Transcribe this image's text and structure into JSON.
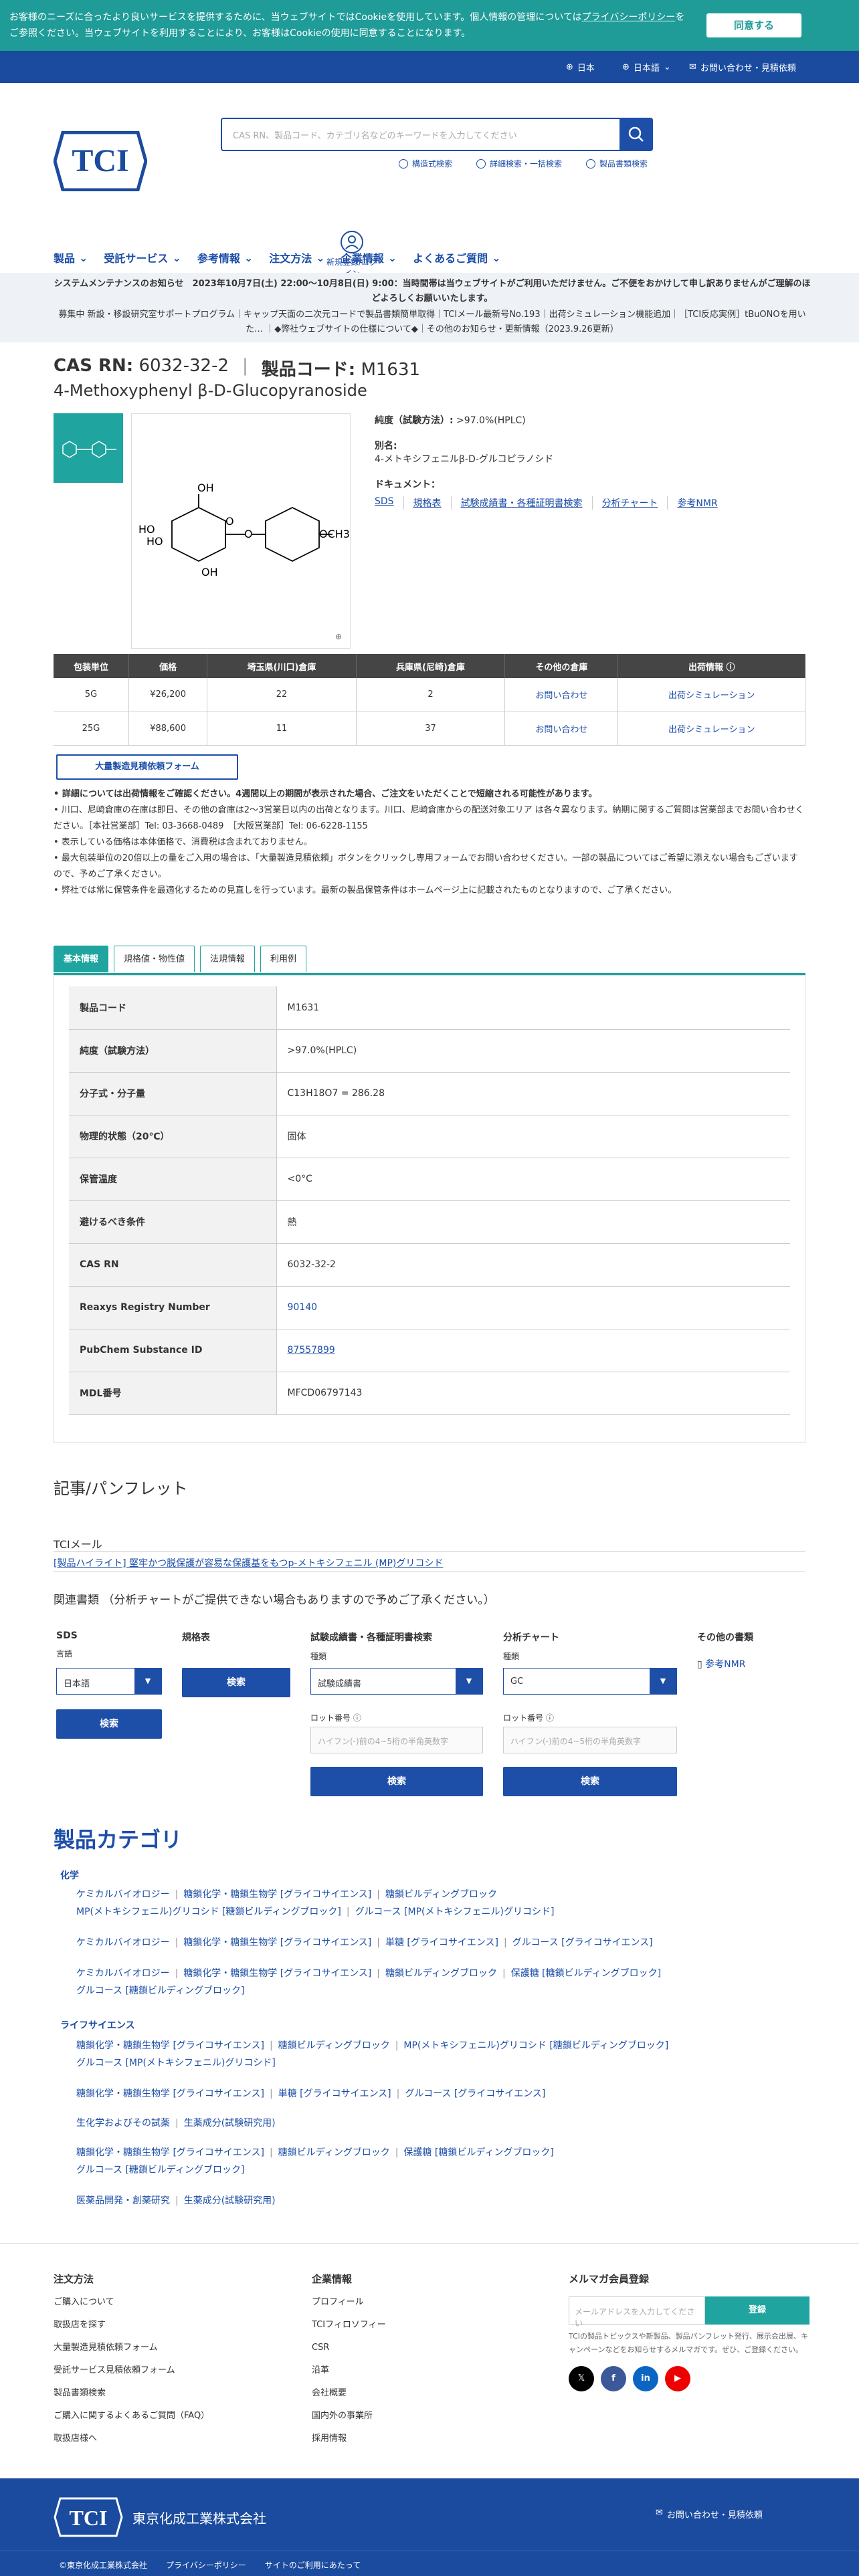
{
  "cookie": {
    "text": "お客様のニーズに合ったより良いサービスを提供するために、当ウェブサイトではCookieを使用しています。個人情報の管理については",
    "link": "プライバシーポリシー",
    "text2": "をご参照ください。当ウェブサイトを利用することにより、お客様はCookieの使用に同意することになります。",
    "button": "同意する"
  },
  "topbar": {
    "country": "日本",
    "language": "日本語",
    "contact": "お問い合わせ・見積依頼"
  },
  "search": {
    "placeholder": "CAS RN、製品コード、カテゴリ名などのキーワードを入力してください",
    "links": [
      "構造式検索",
      "詳細検索・一括検索",
      "製品書類検索"
    ]
  },
  "login": "新規登録/ログイン",
  "nav": [
    "製品",
    "受託サービス",
    "参考情報",
    "注文方法",
    "企業情報",
    "よくあるご質問"
  ],
  "notice": {
    "line1": "システムメンテナンスのお知らせ　2023年10月7日(土) 22:00～10月8日(日) 9:00：当時間帯は当ウェブサイトがご利用いただけません。ご不便をおかけして申し訳ありませんがご理解のほどよろしくお願いいたします。",
    "line2": "募集中 新設・移設研究室サポートプログラム｜キャップ天面の二次元コードで製品書類簡単取得｜TCIメール最新号No.193｜出荷シミュレーション機能追加｜［TCI反応実例］tBuONOを用いた… ｜◆弊社ウェブサイトの仕様について◆｜その他のお知らせ・更新情報（2023.9.26更新）"
  },
  "product": {
    "cas_label": "CAS RN:",
    "cas": "6032-32-2",
    "code_label": "製品コード:",
    "code": "M1631",
    "name": "4-Methoxyphenyl β-D-Glucopyranoside"
  },
  "info": {
    "purity_label": "純度（試験方法）:",
    "purity": ">97.0%(HPLC)",
    "alias_label": "別名:",
    "alias": "4-メトキシフェニルβ-D-グルコピラノシド",
    "docs_label": "ドキュメント：",
    "docs": [
      "SDS",
      "規格表",
      "試験成績書・各種証明書検索",
      "分析チャート",
      "参考NMR"
    ]
  },
  "stock": {
    "headers": [
      "包装単位",
      "価格",
      "埼玉県(川口)倉庫",
      "兵庫県(尼崎)倉庫",
      "その他の倉庫",
      "出荷情報"
    ],
    "rows": [
      [
        "5G",
        "¥26,200",
        "22",
        "2",
        "お問い合わせ",
        "出荷シミュレーション"
      ],
      [
        "25G",
        "¥88,600",
        "11",
        "37",
        "お問い合わせ",
        "出荷シミュレーション"
      ]
    ]
  },
  "bulk_button": "大量製造見積依頼フォーム",
  "notes": [
    "• 詳細については出荷情報をご確認ください。4週間以上の期間が表示された場合、ご注文をいただくことで短縮される可能性があります。",
    "• 川口、尼崎倉庫の在庫は即日、その他の倉庫は2～3営業日以内の出荷となります。川口、尼崎倉庫からの配送対象エリア は各々異なります。納期に関するご質問は営業部までお問い合わせください。［本社営業部］Tel: 03-3668-0489　［大阪営業部］Tel: 06-6228-1155",
    "• 表示している価格は本体価格で、消費税は含まれておりません。",
    "• 最大包装単位の20倍以上の量をご入用の場合は、「大量製造見積依頼」ボタンをクリックし専用フォームでお問い合わせください。一部の製品についてはご希望に添えない場合もございますので、予めご了承ください。",
    "• 弊社では常に保管条件を最適化するための見直しを行っています。最新の製品保管条件はホームページ上に記載されたものとなりますので、ご了承ください。"
  ],
  "tabs": [
    "基本情報",
    "規格値・物性値",
    "法規情報",
    "利用例"
  ],
  "basic": [
    [
      "製品コード",
      "M1631"
    ],
    [
      "純度（試験方法）",
      ">97.0%(HPLC)"
    ],
    [
      "分子式・分子量",
      "C13H18O7 = 286.28"
    ],
    [
      "物理的状態（20℃）",
      "固体"
    ],
    [
      "保管温度",
      "<0°C"
    ],
    [
      "避けるべき条件",
      "熱"
    ],
    [
      "CAS RN",
      "6032-32-2"
    ],
    [
      "Reaxys Registry Number",
      "90140"
    ],
    [
      "PubChem Substance ID",
      "87557899"
    ],
    [
      "MDL番号",
      "MFCD06797143"
    ]
  ],
  "articles": {
    "title": "記事/パンフレット",
    "sub": "TCIメール",
    "link": "[製品ハイライト] 堅牢かつ脱保護が容易な保護基をもつp-メトキシフェニル (MP)グリコシド"
  },
  "related": "関連書類 （分析チャートがご提供できない場合もありますので予めご了承ください。）",
  "docs_forms": {
    "sds": "SDS",
    "lang_label": "言語",
    "lang": "日本語",
    "spec": "規格表",
    "coa": "試験成績書・各種証明書検索",
    "kind_label": "種類",
    "coa_kind": "試験成績書",
    "lot_label": "ロット番号",
    "lot_ph": "ハイフン(-)前の4~5桁の半角英数字",
    "chart": "分析チャート",
    "chart_kind": "GC",
    "other": "その他の書類",
    "nmr": "参考NMR",
    "search": "検索"
  },
  "categories": {
    "title": "製品カテゴリ",
    "chem": "化学",
    "life": "ライフサイエンス",
    "rows": [
      [
        "ケミカルバイオロジー",
        "糖鎖化学・糖鎖生物学 [グライコサイエンス]",
        "糖鎖ビルディングブロック"
      ],
      [
        "MP(メトキシフェニル)グリコシド [糖鎖ビルディングブロック]",
        "グルコース [MP(メトキシフェニル)グリコシド]"
      ],
      [
        "ケミカルバイオロジー",
        "糖鎖化学・糖鎖生物学 [グライコサイエンス]",
        "単糖 [グライコサイエンス]",
        "グルコース [グライコサイエンス]"
      ],
      [
        "ケミカルバイオロジー",
        "糖鎖化学・糖鎖生物学 [グライコサイエンス]",
        "糖鎖ビルディングブロック",
        "保護糖 [糖鎖ビルディングブロック]"
      ],
      [
        "グルコース [糖鎖ビルディングブロック]"
      ],
      [
        "糖鎖化学・糖鎖生物学 [グライコサイエンス]",
        "糖鎖ビルディングブロック",
        "MP(メトキシフェニル)グリコシド [糖鎖ビルディングブロック]"
      ],
      [
        "グルコース [MP(メトキシフェニル)グリコシド]"
      ],
      [
        "糖鎖化学・糖鎖生物学 [グライコサイエンス]",
        "単糖 [グライコサイエンス]",
        "グルコース [グライコサイエンス]"
      ],
      [
        "生化学およびその試薬",
        "生薬成分(試験研究用)"
      ],
      [
        "糖鎖化学・糖鎖生物学 [グライコサイエンス]",
        "糖鎖ビルディングブロック",
        "保護糖 [糖鎖ビルディングブロック]"
      ],
      [
        "グルコース [糖鎖ビルディングブロック]"
      ],
      [
        "医薬品開発・創薬研究",
        "生薬成分(試験研究用)"
      ]
    ]
  },
  "footer": {
    "order_title": "注文方法",
    "order": [
      "ご購入について",
      "取扱店を探す",
      "大量製造見積依頼フォーム",
      "受託サービス見積依頼フォーム",
      "製品書類検索",
      "ご購入に関するよくあるご質問（FAQ）",
      "取扱店様へ"
    ],
    "corp_title": "企業情報",
    "corp": [
      "プロフィール",
      "TCIフィロソフィー",
      "CSR",
      "沿革",
      "会社概要",
      "国内外の事業所",
      "採用情報"
    ],
    "mail_title": "メルマガ会員登録",
    "mail_ph": "メールアドレスを入力してください",
    "mail_btn": "登録",
    "mail_desc": "TCIの製品トピックスや新製品、製品パンフレット発行、展示会出展、キャンペーンなどをお知らせするメルマガです。ぜひ、ご登録ください。",
    "company": "東京化成工業株式会社",
    "contact": "お問い合わせ・見積依頼",
    "copyright": "©東京化成工業株式会社",
    "privacy": "プライバシーポリシー",
    "about": "サイトのご利用にあたって"
  },
  "colors": {
    "brand": "#1a4b9e",
    "teal": "#1fa49f"
  }
}
